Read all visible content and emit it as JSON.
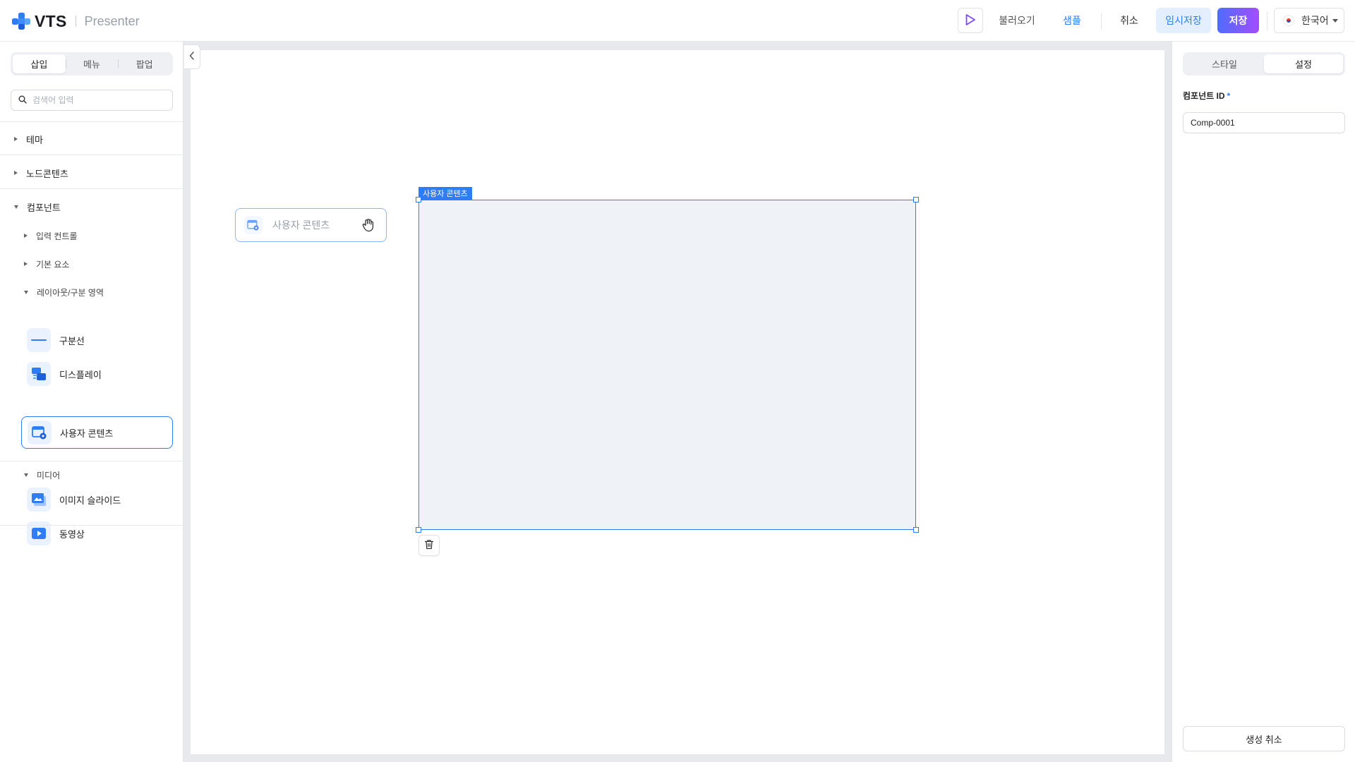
{
  "header": {
    "logo_text": "VTS",
    "logo_sub": "Presenter",
    "play_icon": "play-icon",
    "load_label": "불러오기",
    "sample_label": "샘플",
    "cancel_label": "취소",
    "tempsave_label": "임시저장",
    "save_label": "저장",
    "language": "한국어"
  },
  "sidebar": {
    "tabs": [
      {
        "label": "삽입",
        "active": true
      },
      {
        "label": "메뉴",
        "active": false
      },
      {
        "label": "팝업",
        "active": false
      }
    ],
    "search_placeholder": "검색어 입력",
    "groups": {
      "theme": "테마",
      "node_contents": "노드콘텐츠",
      "component": "컴포넌트"
    },
    "subgroups": {
      "input_controls": "입력 컨트롤",
      "basic_elements": "기본 요소",
      "layout": "레이아웃/구분 영역",
      "media": "미디어"
    },
    "layout_items": [
      {
        "label": "구분선",
        "icon": "divider-icon"
      },
      {
        "label": "디스플레이",
        "icon": "display-icon"
      },
      {
        "label": "사용자 콘텐츠",
        "icon": "user-content-icon",
        "selected": true
      }
    ],
    "media_items": [
      {
        "label": "이미지 슬라이드",
        "icon": "image-slide-icon"
      },
      {
        "label": "동영상",
        "icon": "video-icon"
      }
    ]
  },
  "canvas": {
    "drag_ghost_label": "사용자 콘텐츠",
    "selection_label": "사용자 콘텐츠"
  },
  "right_panel": {
    "tabs": [
      {
        "label": "스타일",
        "active": false
      },
      {
        "label": "설정",
        "active": true
      }
    ],
    "component_id_label": "컴포넌트 ID",
    "required_mark": "*",
    "component_id_value": "Comp-0001",
    "cancel_create_label": "생성 취소"
  },
  "colors": {
    "accent": "#2e7cf6",
    "save_gradient_start": "#4f6cff",
    "save_gradient_end": "#a24dff",
    "canvas_bg": "#e7e9ed"
  }
}
